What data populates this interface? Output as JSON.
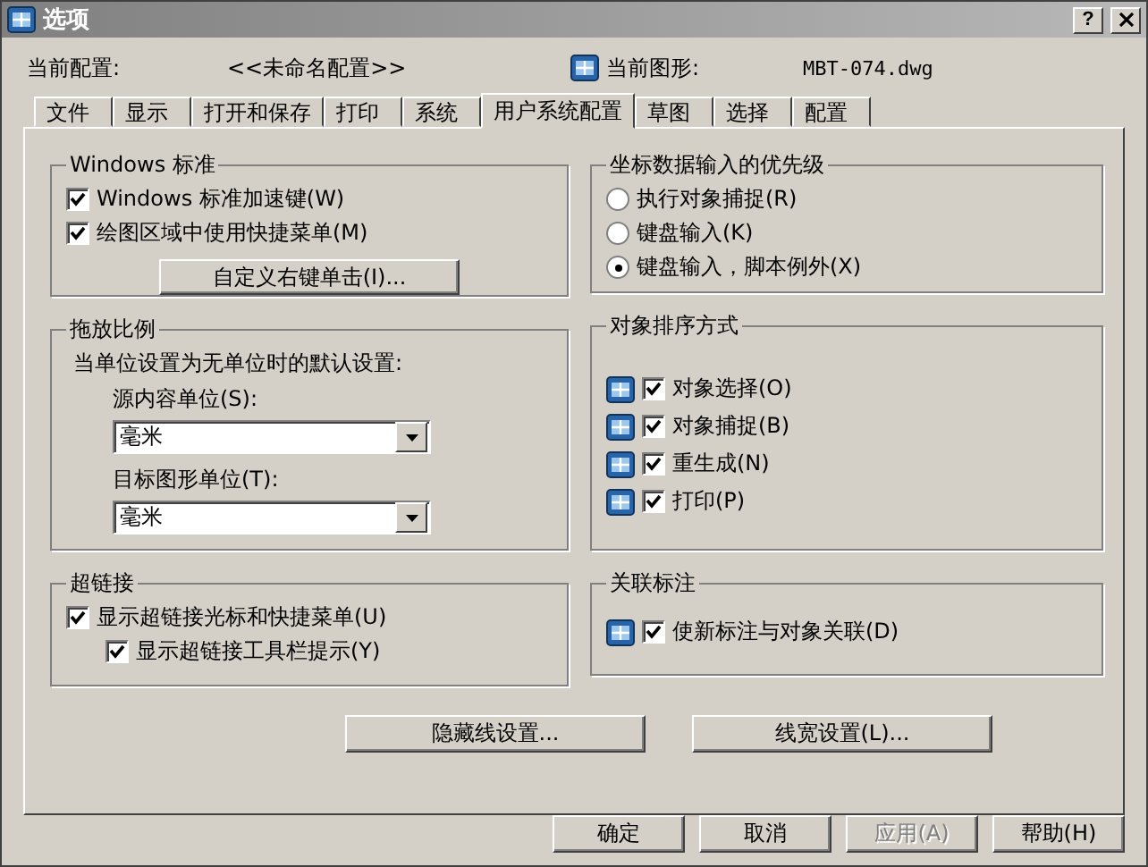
{
  "window": {
    "title": "选项",
    "help_button": "?"
  },
  "header": {
    "profile_label": "当前配置:",
    "profile_value": "<<未命名配置>>",
    "drawing_label": "当前图形:",
    "drawing_value": "MBT-074.dwg"
  },
  "tabs": [
    {
      "label": "文件",
      "selected": false
    },
    {
      "label": "显示",
      "selected": false
    },
    {
      "label": "打开和保存",
      "selected": false
    },
    {
      "label": "打印",
      "selected": false
    },
    {
      "label": "系统",
      "selected": false
    },
    {
      "label": "用户系统配置",
      "selected": true
    },
    {
      "label": "草图",
      "selected": false
    },
    {
      "label": "选择",
      "selected": false
    },
    {
      "label": "配置",
      "selected": false
    }
  ],
  "windows_standard": {
    "title": "Windows 标准",
    "options": [
      {
        "label": "Windows 标准加速键(W)",
        "checked": true
      },
      {
        "label": "绘图区域中使用快捷菜单(M)",
        "checked": true
      }
    ],
    "button": "自定义右键单击(I)..."
  },
  "insert_scale": {
    "title": "拖放比例",
    "description": "当单位设置为无单位时的默认设置:",
    "fields": [
      {
        "label": "源内容单位(S):",
        "value": "毫米"
      },
      {
        "label": "目标图形单位(T):",
        "value": "毫米"
      }
    ]
  },
  "hyperlink": {
    "title": "超链接",
    "options": [
      {
        "label": "显示超链接光标和快捷菜单(U)",
        "checked": true,
        "children": [
          {
            "label": "显示超链接工具栏提示(Y)",
            "checked": true
          }
        ]
      }
    ]
  },
  "coordinate_priority": {
    "title": "坐标数据输入的优先级",
    "options": [
      {
        "label": "执行对象捕捉(R)",
        "selected": false
      },
      {
        "label": "键盘输入(K)",
        "selected": false
      },
      {
        "label": "键盘输入，脚本例外(X)",
        "selected": true
      }
    ]
  },
  "object_sorting": {
    "title": "对象排序方式",
    "options": [
      {
        "label": "对象选择(O)",
        "checked": true
      },
      {
        "label": "对象捕捉(B)",
        "checked": true
      },
      {
        "label": "重生成(N)",
        "checked": true
      },
      {
        "label": "打印(P)",
        "checked": true
      }
    ]
  },
  "associative_dimensioning": {
    "title": "关联标注",
    "options": [
      {
        "label": "使新标注与对象关联(D)",
        "checked": true
      }
    ]
  },
  "panel_buttons": [
    "隐藏线设置...",
    "线宽设置(L)..."
  ],
  "buttons": [
    {
      "label": "确定",
      "disabled": false
    },
    {
      "label": "取消",
      "disabled": false
    },
    {
      "label": "应用(A)",
      "disabled": true
    },
    {
      "label": "帮助(H)",
      "disabled": false
    }
  ]
}
